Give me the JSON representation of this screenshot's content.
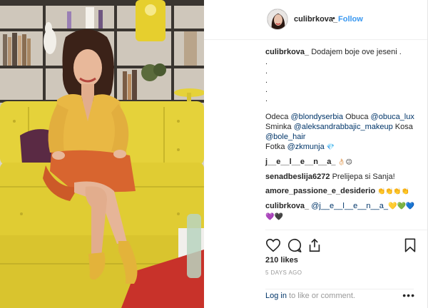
{
  "post": {
    "username": "culibrkova_",
    "dot": "•",
    "follow_label": "Follow"
  },
  "caption": {
    "username": "culibrkova_",
    "text": "Dodajem boje ove jeseni .",
    "dots": [
      ".",
      ".",
      ".",
      ".",
      "."
    ],
    "credits": [
      {
        "label": "Odeca ",
        "tag": "@blondyserbia",
        "label2": " Obuca ",
        "tag2": "@obuca_lux"
      },
      {
        "label": "Sminka ",
        "tag": "@aleksandrabbajic_makeup",
        "label2": " Kosa",
        "tag2": ""
      },
      {
        "label": "",
        "tag": "@bole_hair",
        "label2": "",
        "tag2": ""
      },
      {
        "label": "Fotka ",
        "tag": "@zkmunja",
        "label2": " 💎",
        "tag2": ""
      }
    ]
  },
  "comments": [
    {
      "username": "j__e__l__e__n__a_",
      "text": " 👌🏻😉"
    },
    {
      "username": "senadbeslija6272",
      "text": " Prelijepa si Sanja!"
    },
    {
      "username": "amore_passione_e_desiderio",
      "text": " 👏👏👏👏"
    },
    {
      "username": "culibrkova_",
      "text": " ",
      "tag": "@j__e__l__e__n__a_",
      "hearts": "💛💚💙💜🖤"
    }
  ],
  "engagement": {
    "likes": "210 likes",
    "time": "5 DAYS AGO"
  },
  "footer": {
    "login_link": "Log in",
    "login_rest": " to like or comment.",
    "more": "•••"
  },
  "colors": {
    "link": "#003569",
    "follow": "#3897f0",
    "sofa": "#e5d23a",
    "blouse": "#e9b844",
    "skirt": "#d8652f"
  },
  "icons": [
    "heart-icon",
    "comment-icon",
    "share-icon",
    "bookmark-icon",
    "more-options-icon"
  ]
}
